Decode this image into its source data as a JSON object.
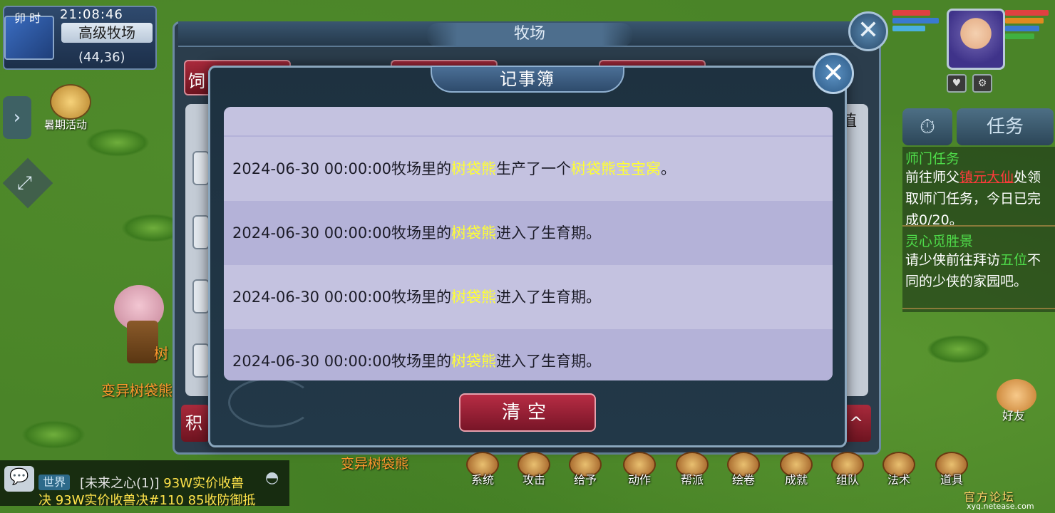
{
  "location": {
    "time_period": "卯 时",
    "clock": "21:08:46",
    "map_name": "高级牧场",
    "coords": "(44,36)"
  },
  "side": {
    "event_label": "暑期活动"
  },
  "pasture": {
    "title": "牧场",
    "left_tab_fragment": "饲",
    "right_col_fragment": "值",
    "bottom_left_fragment": "积",
    "bottom_right_fragment": "^"
  },
  "notebook": {
    "title": "记事簿",
    "entries": [
      {
        "prefix": "2024-06-30 00:00:00牧场里的",
        "pet": "树袋熊",
        "middle": "生产了一个",
        "item": "树袋熊宝宝窝",
        "suffix": "。"
      },
      {
        "prefix": "2024-06-30 00:00:00牧场里的",
        "pet": "树袋熊",
        "middle": "进入了生育期。",
        "item": "",
        "suffix": ""
      },
      {
        "prefix": "2024-06-30 00:00:00牧场里的",
        "pet": "树袋熊",
        "middle": "进入了生育期。",
        "item": "",
        "suffix": ""
      },
      {
        "prefix": "2024-06-30 00:00:00牧场里的",
        "pet": "树袋熊",
        "middle": "进入了生育期。",
        "item": "",
        "suffix": ""
      }
    ],
    "clear_label": "清空"
  },
  "hud": {
    "task_tab": "任务",
    "quest1": {
      "title": "师门任务",
      "text_before": "前往师父",
      "npc": "镇元大仙",
      "text_after": "处领取师门任务，今日已完成0/20。"
    },
    "quest2": {
      "title": "灵心觅胜景",
      "text_before": "请少侠前往拜访",
      "highlight": "五位",
      "text_after": "不同的少侠的家园吧。"
    },
    "friend_label": "好友",
    "hp_colors": [
      "#e04040",
      "#3a7ad0",
      "#4ab0e0"
    ],
    "hp_colors2": [
      "#e04040",
      "#e08a20",
      "#3a7ad0",
      "#40b040"
    ]
  },
  "creatures": {
    "label1": "变异树袋熊",
    "label2": "变异树袋熊",
    "label_fragment": "树"
  },
  "bottom_bar": [
    "系统",
    "攻击",
    "给予",
    "动作",
    "帮派",
    "绘卷",
    "成就",
    "组队",
    "法术",
    "道具"
  ],
  "chat": {
    "channel": "世界",
    "sender": "[未来之心(1)]",
    "msg1": "93W实价收兽",
    "msg2": "决 93W实价收兽决#110 85收防御抵"
  },
  "watermark": {
    "text": "官方论坛",
    "url": "xyq.netease.com"
  }
}
